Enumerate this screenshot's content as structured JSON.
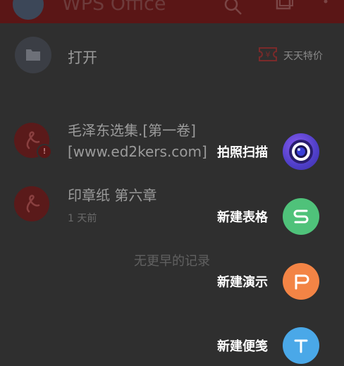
{
  "topbar": {
    "title": "WPS Office",
    "icons": [
      "search-icon",
      "files-icon",
      "more-icon"
    ]
  },
  "open_row": {
    "label": "打开",
    "deal_label": "天天特价"
  },
  "documents": [
    {
      "name": "毛泽东选集.[第一卷][www.ed2kers.com]",
      "time": ""
    },
    {
      "name": "印章纸 第六章",
      "time": "1 天前"
    }
  ],
  "no_more": "无更早的记录",
  "fab_menu": [
    {
      "label": "拍照扫描",
      "icon": "camera-scan-icon",
      "color": "#5b45d6"
    },
    {
      "label": "新建表格",
      "icon": "spreadsheet-s-icon",
      "color": "#4fc27a"
    },
    {
      "label": "新建演示",
      "icon": "presentation-p-icon",
      "color": "#f38445"
    },
    {
      "label": "新建便笺",
      "icon": "note-t-icon",
      "color": "#4aa8e8"
    }
  ]
}
